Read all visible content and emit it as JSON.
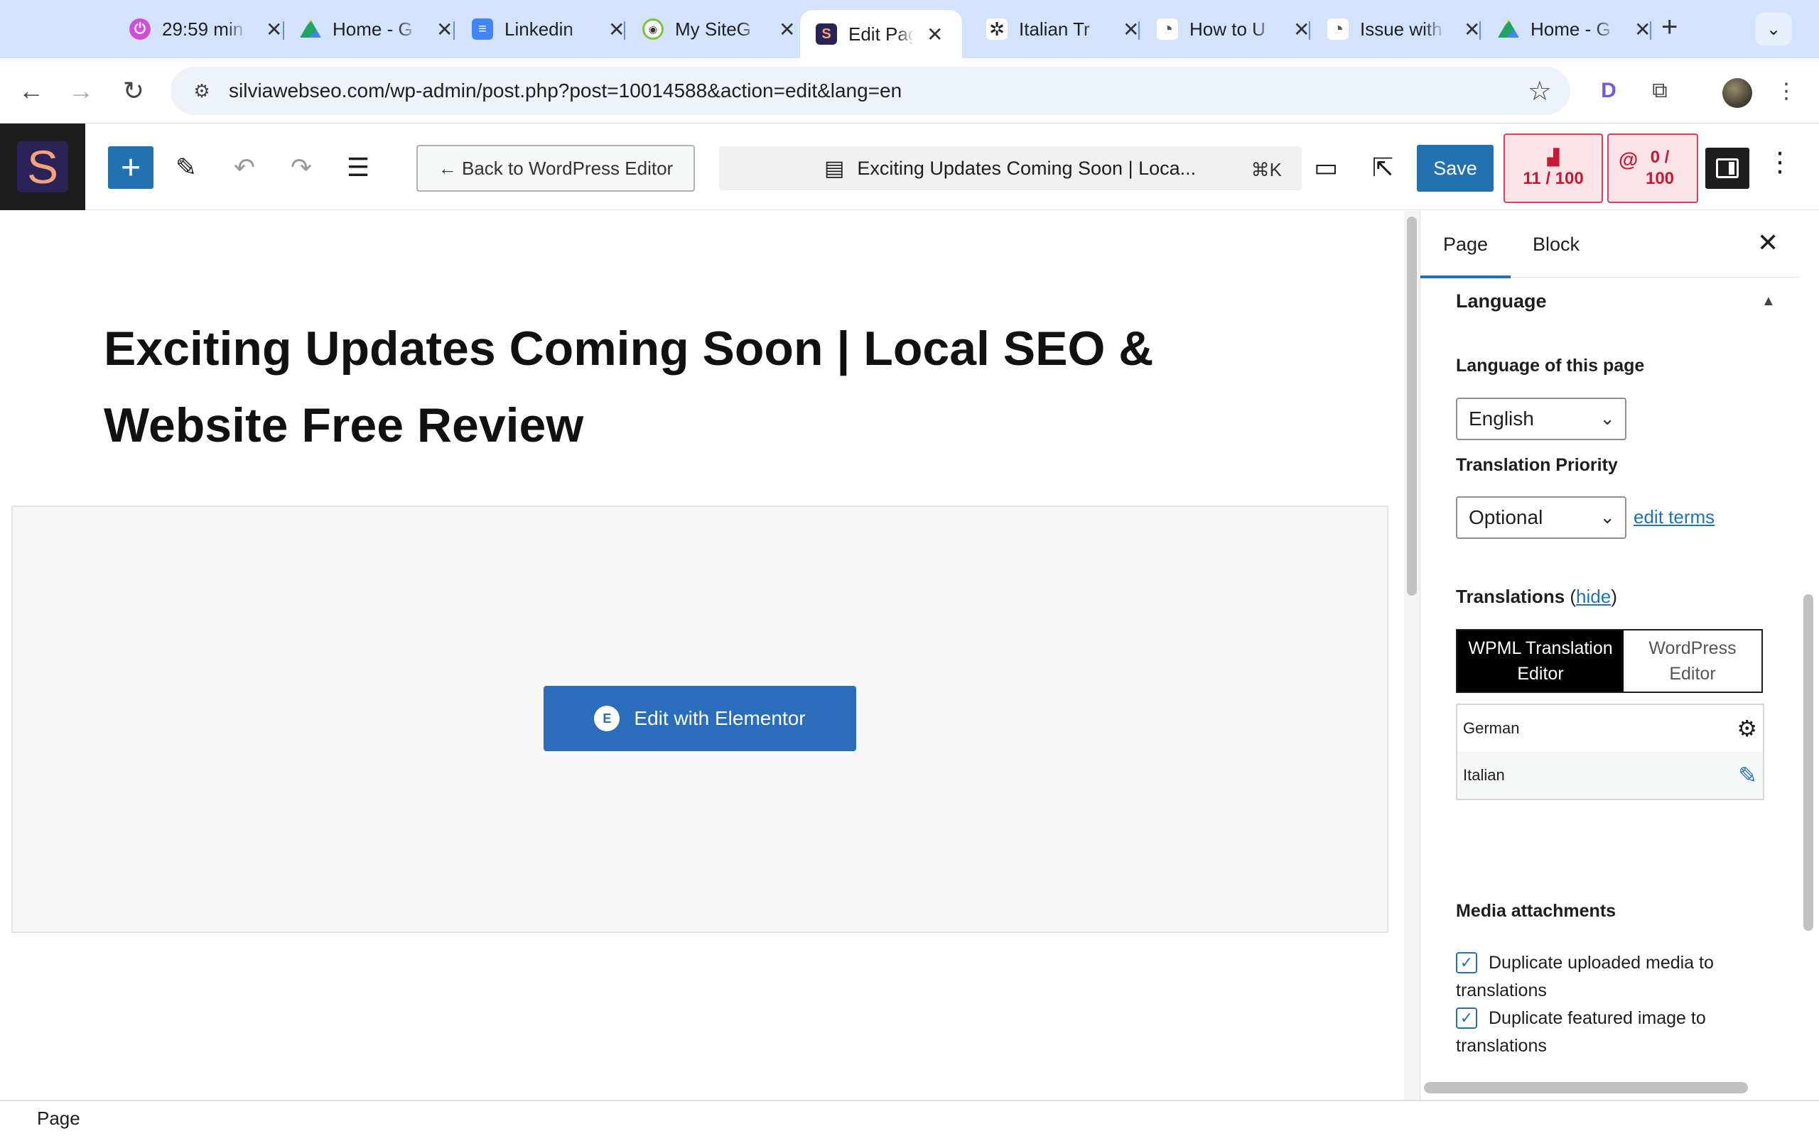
{
  "browser": {
    "tabs": [
      {
        "title": "29:59 min",
        "icon": "timer-icon",
        "color": "#d04fd4"
      },
      {
        "title": "Home - G",
        "icon": "google-drive-icon",
        "color": "#1fa463"
      },
      {
        "title": "Linkedin",
        "icon": "google-docs-icon",
        "color": "#4285f4"
      },
      {
        "title": "My SiteG",
        "icon": "sitegpt-icon",
        "color": "#7cc242"
      },
      {
        "title": "Edit Page",
        "icon": "site-s-icon",
        "color": "#2b2258"
      },
      {
        "title": "Italian Tr",
        "icon": "openai-icon",
        "color": "#222222"
      },
      {
        "title": "How to U",
        "icon": "wpml-support-icon",
        "color": "#555555"
      },
      {
        "title": "Issue with",
        "icon": "wpml-support-icon",
        "color": "#555555"
      },
      {
        "title": "Home - G",
        "icon": "google-drive-icon",
        "color": "#1fa463"
      }
    ],
    "url": "silviawebseo.com/wp-admin/post.php?post=10014588&action=edit&lang=en"
  },
  "editor": {
    "site_letter": "S",
    "back_label": "← Back to WordPress Editor",
    "command_title": "Exciting Updates Coming Soon | Loca...",
    "command_shortcut": "⌘K",
    "save_label": "Save",
    "seo_score": {
      "line1": "11 / 100"
    },
    "readability_score": {
      "line1": "0 /",
      "line2": "100"
    }
  },
  "canvas": {
    "post_title": "Exciting Updates Coming Soon | Local SEO & Website Free Review",
    "elementor_label": "Edit with Elementor"
  },
  "sidebar": {
    "tab_page": "Page",
    "tab_block": "Block",
    "section_title": "Language",
    "language_label": "Language of this page",
    "language_value": "English",
    "priority_label": "Translation Priority",
    "priority_value": "Optional",
    "edit_terms": "edit terms",
    "translations_label": "Translations",
    "translations_open": " (",
    "hide_link": "hide",
    "translations_close": ")",
    "editor_on_line1": "WPML Translation",
    "editor_on_line2": "Editor",
    "editor_off_line1": "WordPress",
    "editor_off_line2": "Editor",
    "languages": [
      {
        "name": "German",
        "action_icon": "gear-icon"
      },
      {
        "name": "Italian",
        "action_icon": "pencil-icon"
      }
    ],
    "media_title": "Media attachments",
    "dup_media": "Duplicate uploaded media to translations",
    "dup_featured": "Duplicate featured image to translations"
  },
  "footer": {
    "breadcrumb": "Page"
  }
}
